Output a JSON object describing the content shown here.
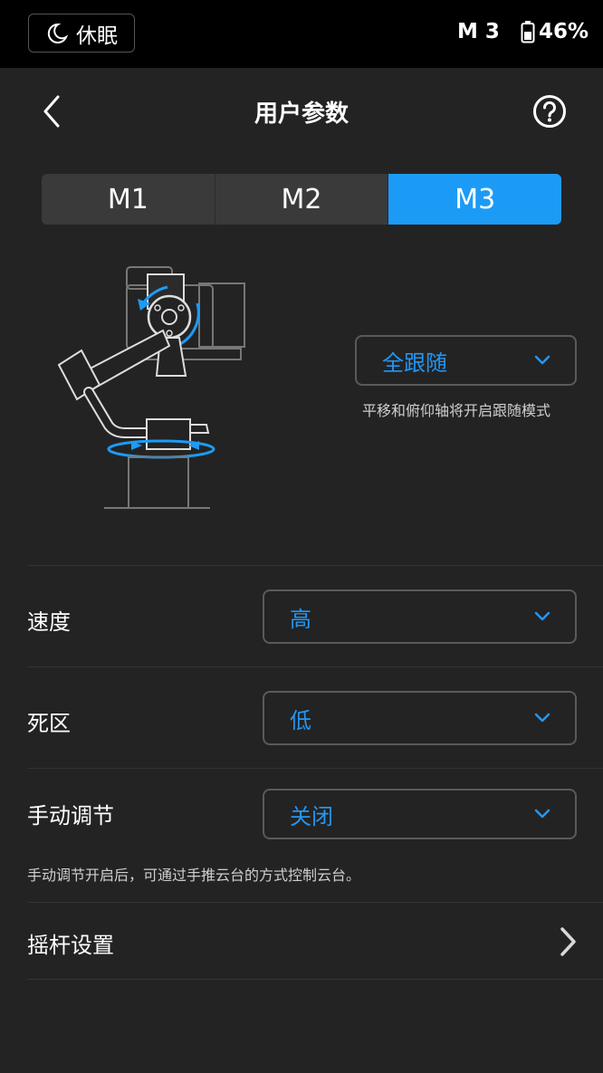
{
  "status_bar": {
    "sleep_label": "休眠",
    "mode_indicator": "M 3",
    "battery_percent": "46%"
  },
  "header": {
    "title": "用户参数"
  },
  "mode_tabs": [
    {
      "label": "M1",
      "active": false
    },
    {
      "label": "M2",
      "active": false
    },
    {
      "label": "M3",
      "active": true
    }
  ],
  "follow_mode": {
    "selected": "全跟随",
    "description": "平移和俯仰轴将开启跟随模式"
  },
  "settings": {
    "speed": {
      "label": "速度",
      "value": "高"
    },
    "deadband": {
      "label": "死区",
      "value": "低"
    },
    "manual_adjust": {
      "label": "手动调节",
      "value": "关闭"
    }
  },
  "manual_note": "手动调节开启后，可通过手推云台的方式控制云台。",
  "joystick_settings": {
    "label": "摇杆设置"
  },
  "colors": {
    "accent": "#1c9bf6",
    "background": "#232323",
    "status_bar": "#000000"
  }
}
